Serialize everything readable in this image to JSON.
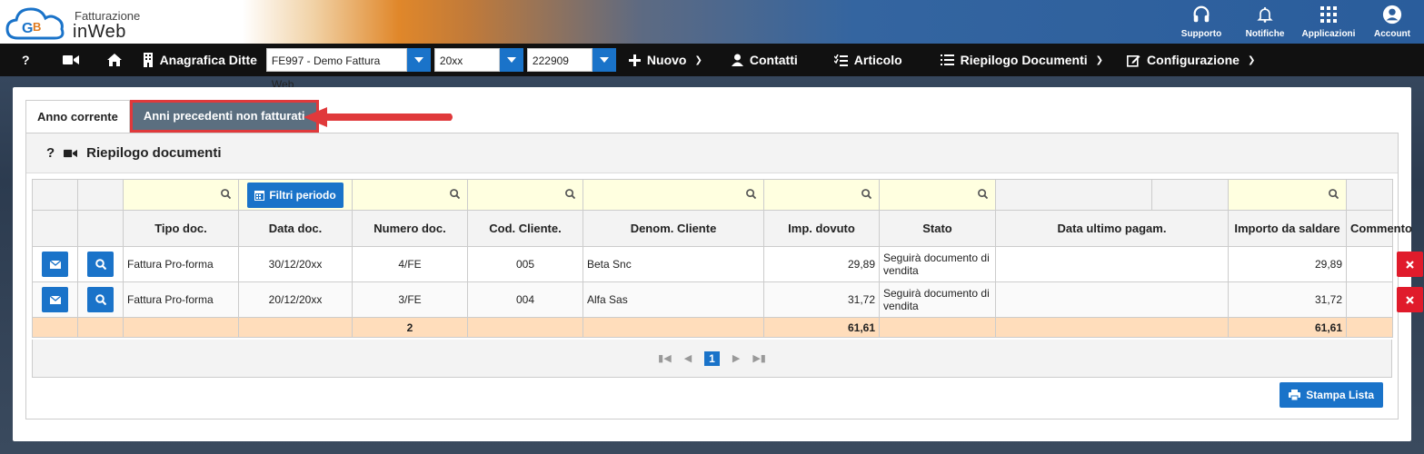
{
  "brand": {
    "line1": "Fatturazione",
    "line2": "inWeb"
  },
  "top_icons": [
    {
      "label": "Supporto",
      "icon": "headset-icon"
    },
    {
      "label": "Notifiche",
      "icon": "bell-icon"
    },
    {
      "label": "Applicazioni",
      "icon": "grid-icon"
    },
    {
      "label": "Account",
      "icon": "user-circle-icon"
    }
  ],
  "navbar": {
    "help": "?",
    "anagrafica": "Anagrafica Ditte",
    "company_select": "FE997 - Demo Fattura Web",
    "year_select": "20xx",
    "code_select": "222909",
    "nuovo": "Nuovo",
    "contatti": "Contatti",
    "articolo": "Articolo",
    "riepilogo": "Riepilogo Documenti",
    "configurazione": "Configurazione"
  },
  "tabs": [
    "Anno corrente",
    "Anni precedenti non fatturati"
  ],
  "section": {
    "help": "?",
    "title": "Riepilogo documenti"
  },
  "filters": {
    "filtri_periodo": "Filtri periodo"
  },
  "columns": [
    "Tipo doc.",
    "Data doc.",
    "Numero doc.",
    "Cod. Cliente.",
    "Denom. Cliente",
    "Imp. dovuto",
    "Stato",
    "Data ultimo pagam.",
    "Importo da saldare",
    "Commento"
  ],
  "rows": [
    {
      "tipo": "Fattura Pro-forma",
      "data": "30/12/20xx",
      "numero": "4/FE",
      "cod": "005",
      "denom": "Beta Snc",
      "imp": "29,89",
      "stato": "Seguirà documento di vendita",
      "data_pag": "",
      "saldare": "29,89",
      "commento": ""
    },
    {
      "tipo": "Fattura Pro-forma",
      "data": "20/12/20xx",
      "numero": "3/FE",
      "cod": "004",
      "denom": "Alfa Sas",
      "imp": "31,72",
      "stato": "Seguirà documento di vendita",
      "data_pag": "",
      "saldare": "31,72",
      "commento": ""
    }
  ],
  "totals": {
    "count": "2",
    "imp": "61,61",
    "saldare": "61,61"
  },
  "pager": {
    "current": "1"
  },
  "stampa": "Stampa Lista",
  "colors": {
    "accent": "#1a73c9",
    "danger": "#e01b2b",
    "total_row": "#ffddbb",
    "filter_row": "#ffffe0",
    "tab_active": "#5b6f80",
    "highlight": "#e0393b"
  }
}
